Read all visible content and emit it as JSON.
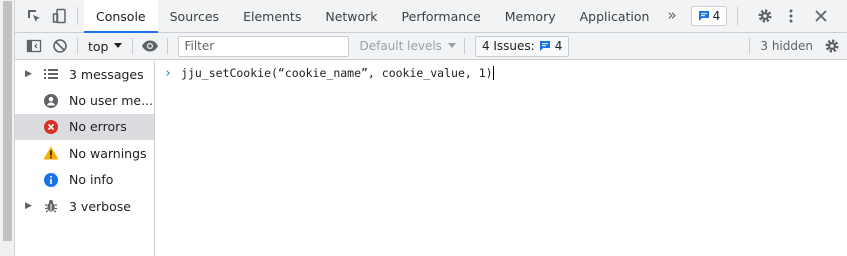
{
  "tabs": [
    {
      "label": "Console",
      "active": true
    },
    {
      "label": "Sources"
    },
    {
      "label": "Elements"
    },
    {
      "label": "Network"
    },
    {
      "label": "Performance"
    },
    {
      "label": "Memory"
    },
    {
      "label": "Application"
    }
  ],
  "more_tabs_glyph": "»",
  "issues_badge_count": "4",
  "toolbar": {
    "context": "top",
    "filter_placeholder": "Filter",
    "levels": "Default levels",
    "issues_label": "4 Issues:",
    "issues_count": "4",
    "hidden": "3 hidden"
  },
  "sidebar": [
    {
      "label": "3 messages",
      "icon": "list-icon",
      "expandable": true
    },
    {
      "label": "No user me...",
      "icon": "user-icon",
      "expandable": false
    },
    {
      "label": "No errors",
      "icon": "error-icon",
      "expandable": false,
      "selected": true
    },
    {
      "label": "No warnings",
      "icon": "warning-icon",
      "expandable": false
    },
    {
      "label": "No info",
      "icon": "info-icon",
      "expandable": false
    },
    {
      "label": "3 verbose",
      "icon": "bug-icon",
      "expandable": true
    }
  ],
  "console": {
    "prompt_text": "jju_setCookie(“cookie_name”, cookie_value, 1)"
  },
  "colors": {
    "accent": "#1a73e8",
    "error": "#d93025",
    "warning": "#f9ab00",
    "info": "#1a73e8"
  }
}
